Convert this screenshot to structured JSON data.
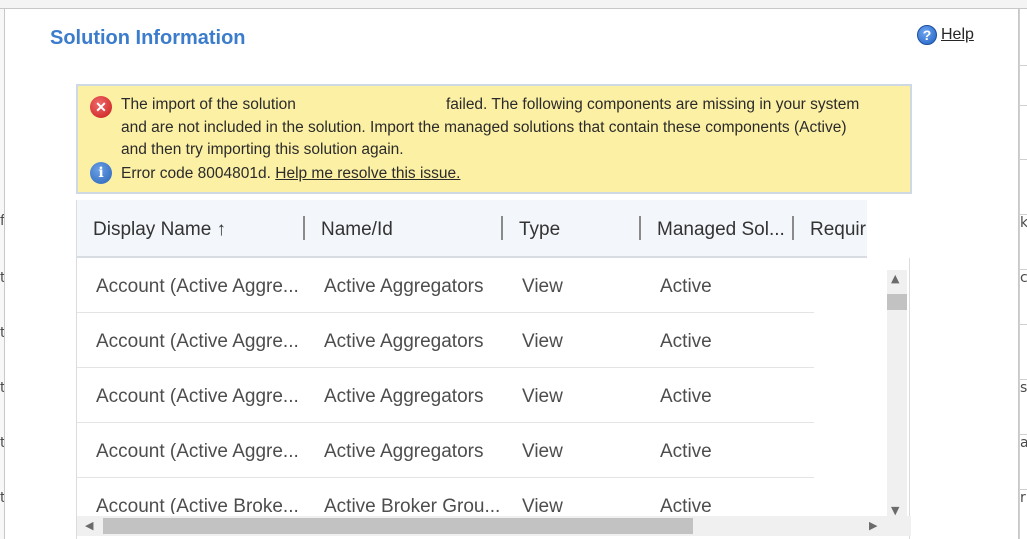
{
  "title": "Solution Information",
  "help": {
    "label": "Help"
  },
  "banner": {
    "line1_prefix": "The import of the solution",
    "line1_suffix": "failed. The following components are missing in your system",
    "line2": "and are not included in the solution. Import the managed solutions that contain these components (Active)",
    "line3": "and then try importing this solution again.",
    "error_code_text": "Error code 8004801d.",
    "resolve_link": "Help me resolve this issue."
  },
  "grid": {
    "columns": [
      "Display Name ↑",
      "Name/Id",
      "Type",
      "Managed Sol...",
      "Requir"
    ],
    "rows": [
      [
        "Account (Active Aggre...",
        "Active Aggregators",
        "View",
        "Active"
      ],
      [
        "Account (Active Aggre...",
        "Active Aggregators",
        "View",
        "Active"
      ],
      [
        "Account (Active Aggre...",
        "Active Aggregators",
        "View",
        "Active"
      ],
      [
        "Account (Active Aggre...",
        "Active Aggregators",
        "View",
        "Active"
      ],
      [
        "Account (Active Broke...",
        "Active Broker Grou...",
        "View",
        "Active"
      ]
    ]
  },
  "background_glyphs": {
    "left": [
      "f",
      "t",
      "t",
      "t",
      "t",
      "t"
    ],
    "right": [
      "k",
      "c",
      "s",
      "a",
      "r"
    ]
  }
}
